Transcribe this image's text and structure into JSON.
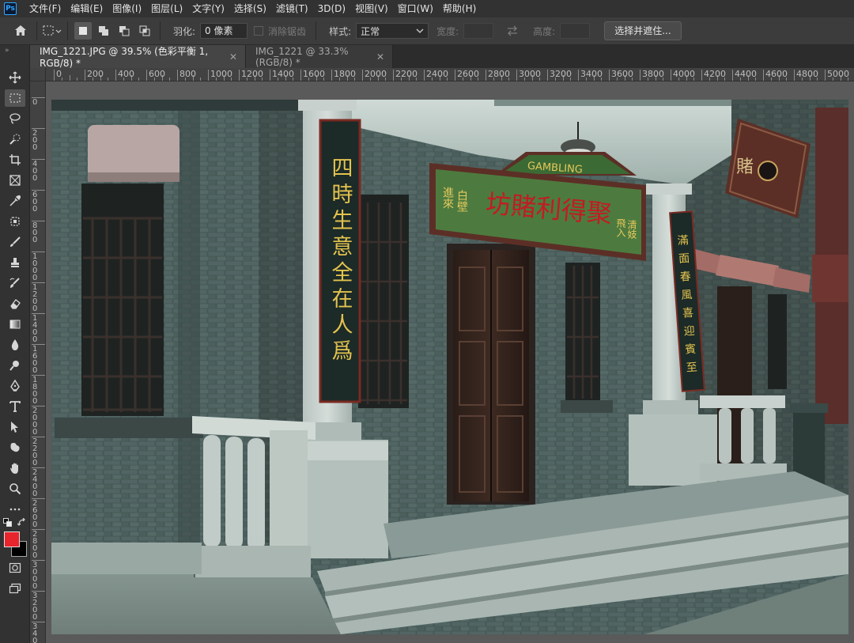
{
  "app": {
    "logo_text": "Ps"
  },
  "menu": [
    "文件(F)",
    "编辑(E)",
    "图像(I)",
    "图层(L)",
    "文字(Y)",
    "选择(S)",
    "滤镜(T)",
    "3D(D)",
    "视图(V)",
    "窗口(W)",
    "帮助(H)"
  ],
  "options": {
    "feather_label": "羽化:",
    "feather_value": "0 像素",
    "antialias_label": "消除锯齿",
    "style_label": "样式:",
    "style_value": "正常",
    "width_label": "宽度:",
    "height_label": "高度:",
    "select_mask_button": "选择并遮住..."
  },
  "tabs": [
    {
      "title": "IMG_1221.JPG @ 39.5% (色彩平衡 1, RGB/8) *",
      "active": true
    },
    {
      "title": "IMG_1221 @ 33.3%(RGB/8) *",
      "active": false
    }
  ],
  "ruler_top_labels": [
    "0",
    "200",
    "400",
    "600",
    "800",
    "1000",
    "1200",
    "1400",
    "1600",
    "1800",
    "2000",
    "2200",
    "2400",
    "2600",
    "2800",
    "3000",
    "3200",
    "3400",
    "3600",
    "3800",
    "4000",
    "4200",
    "4400",
    "4600",
    "4800",
    "5000"
  ],
  "ruler_left_labels": [
    "0",
    "2\n0\n0",
    "4\n0\n0",
    "6\n0\n0",
    "8\n0\n0",
    "1\n0\n0\n0",
    "1\n2\n0\n0",
    "1\n4\n0\n0",
    "1\n6\n0\n0",
    "1\n8\n0\n0",
    "2\n0\n0\n0",
    "2\n2\n0\n0",
    "2\n4\n0\n0",
    "2\n6\n0\n0",
    "2\n8\n0\n0",
    "3\n0\n0\n0",
    "3\n2\n0\n0",
    "3\n4\n0\n0"
  ],
  "colors": {
    "foreground": "#e8242c",
    "background": "#000000"
  },
  "photo": {
    "left_couplet": "四時生意全在人爲",
    "right_couplet": "滿面春風喜迎賓至",
    "sign_main": "坊賭利得聚",
    "sign_top": "GAMBLING",
    "sign_left_1": "白壁",
    "sign_left_2": "進來",
    "sign_right_1": "清妓",
    "sign_right_2": "飛入"
  }
}
